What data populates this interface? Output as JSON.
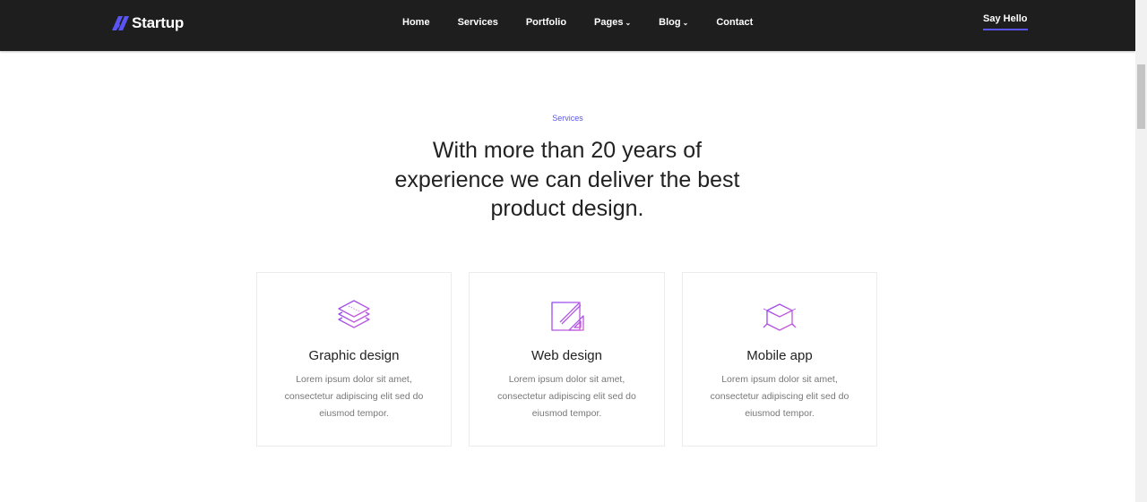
{
  "brand": {
    "name": "Startup",
    "accent": "#5a55f2"
  },
  "nav": {
    "items": [
      {
        "label": "Home",
        "dropdown": false
      },
      {
        "label": "Services",
        "dropdown": false
      },
      {
        "label": "Portfolio",
        "dropdown": false
      },
      {
        "label": "Pages",
        "dropdown": true
      },
      {
        "label": "Blog",
        "dropdown": true
      },
      {
        "label": "Contact",
        "dropdown": false
      }
    ],
    "cta": "Say Hello"
  },
  "section": {
    "eyebrow": "Services",
    "heading": "With more than 20 years of experience we can deliver the best product design."
  },
  "cards": [
    {
      "title": "Graphic design",
      "desc": "Lorem ipsum dolor sit amet, consectetur adipiscing elit sed do eiusmod tempor.",
      "icon": "layers-icon"
    },
    {
      "title": "Web design",
      "desc": "Lorem ipsum dolor sit amet, consectetur adipiscing elit sed do eiusmod tempor.",
      "icon": "drafting-icon"
    },
    {
      "title": "Mobile app",
      "desc": "Lorem ipsum dolor sit amet, consectetur adipiscing elit sed do eiusmod tempor.",
      "icon": "cube-icon"
    }
  ],
  "colors": {
    "nav_bg": "#1e1e1e",
    "icon_gradient_start": "#9a4cf0",
    "icon_gradient_end": "#c75bd8"
  }
}
